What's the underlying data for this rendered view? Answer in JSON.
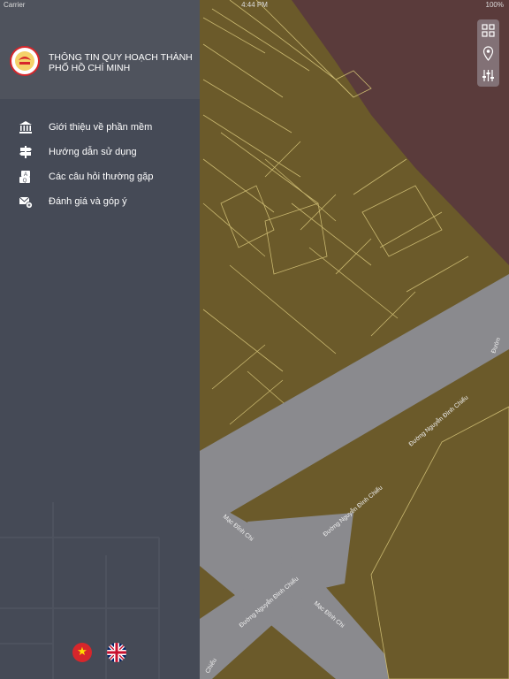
{
  "status_bar": {
    "carrier": "Carrier",
    "time": "4:44 PM",
    "battery": "100%"
  },
  "drawer": {
    "title": "THÔNG TIN QUY HOẠCH THÀNH PHỐ HỒ CHÍ MINH",
    "menu": [
      {
        "label": "Giới thiệu về phần mềm",
        "icon": "bank-icon"
      },
      {
        "label": "Hướng dẫn sử dụng",
        "icon": "signpost-icon"
      },
      {
        "label": "Các câu hỏi thường gặp",
        "icon": "faq-icon"
      },
      {
        "label": "Đánh giá và góp ý",
        "icon": "feedback-mail-icon"
      }
    ],
    "languages": [
      "vietnamese-flag",
      "uk-flag"
    ]
  },
  "map": {
    "streets": [
      "Đường Nguyễn Đình Chiểu",
      "Đường Nguyễn Đình Chiểu",
      "Đường Nguyễn Đình Chiểu",
      "Mạc Đĩnh Chi",
      "Mạc Đĩnh Chi",
      "Đườn",
      "Chiểu"
    ],
    "colors": {
      "land": "#6b5a2a",
      "land_red": "#5a3b3b",
      "road": "#8a8a8e",
      "parcel_line": "#c9b870"
    }
  },
  "map_controls": [
    "grid-icon",
    "location-pin-icon",
    "sliders-icon"
  ]
}
